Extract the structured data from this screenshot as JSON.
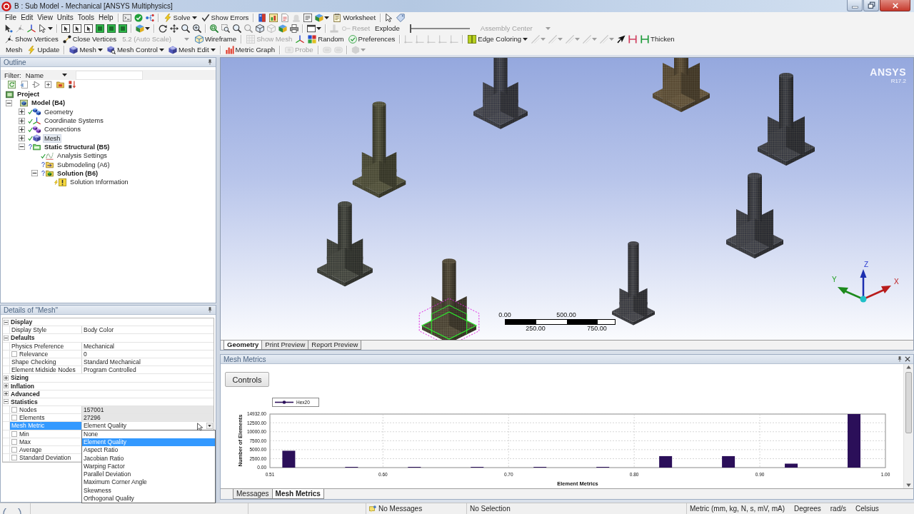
{
  "window": {
    "title": "B : Sub Model - Mechanical [ANSYS Multiphysics]"
  },
  "menu": [
    "File",
    "Edit",
    "View",
    "Units",
    "Tools",
    "Help"
  ],
  "toolbars": [
    {
      "items": [
        {
          "kind": "separator"
        },
        {
          "kind": "icon",
          "dropdown": false,
          "disabled": false
        },
        {
          "kind": "icon",
          "dropdown": false,
          "disabled": false
        },
        {
          "kind": "icon",
          "dropdown": false,
          "disabled": false
        },
        {
          "kind": "separator"
        },
        {
          "kind": "button",
          "label": "Solve",
          "dropdown": true,
          "disabled": false
        },
        {
          "kind": "button",
          "label": "Show Errors",
          "dropdown": false,
          "disabled": false
        },
        {
          "kind": "separator"
        },
        {
          "kind": "icon",
          "dropdown": false,
          "disabled": false
        },
        {
          "kind": "icon",
          "dropdown": false,
          "disabled": false
        },
        {
          "kind": "icon",
          "dropdown": false,
          "disabled": false
        },
        {
          "kind": "icon",
          "dropdown": false,
          "disabled": true
        },
        {
          "kind": "icon",
          "dropdown": false,
          "disabled": false
        },
        {
          "kind": "icon",
          "dropdown": true,
          "disabled": false
        },
        {
          "kind": "button",
          "label": "Worksheet",
          "dropdown": false,
          "disabled": false
        },
        {
          "kind": "separator"
        },
        {
          "kind": "icon",
          "dropdown": false,
          "disabled": false
        },
        {
          "kind": "icon",
          "dropdown": false,
          "disabled": false
        }
      ]
    },
    {
      "items": [
        {
          "kind": "icon",
          "dropdown": false,
          "disabled": false
        },
        {
          "kind": "icon",
          "dropdown": false,
          "disabled": true
        },
        {
          "kind": "icon",
          "dropdown": false,
          "disabled": false
        },
        {
          "kind": "icon",
          "dropdown": true,
          "disabled": false
        },
        {
          "kind": "separator"
        },
        {
          "kind": "icon",
          "dropdown": false,
          "disabled": false
        },
        {
          "kind": "icon",
          "dropdown": false,
          "disabled": false
        },
        {
          "kind": "icon",
          "dropdown": false,
          "disabled": false
        },
        {
          "kind": "icon",
          "dropdown": false,
          "disabled": false
        },
        {
          "kind": "icon",
          "dropdown": false,
          "disabled": false
        },
        {
          "kind": "icon",
          "dropdown": false,
          "disabled": false
        },
        {
          "kind": "separator"
        },
        {
          "kind": "icon",
          "dropdown": true,
          "disabled": false
        },
        {
          "kind": "separator"
        },
        {
          "kind": "icon",
          "dropdown": false,
          "disabled": false
        },
        {
          "kind": "icon",
          "dropdown": false,
          "disabled": false
        },
        {
          "kind": "icon",
          "dropdown": false,
          "disabled": false
        },
        {
          "kind": "icon",
          "dropdown": false,
          "disabled": false
        },
        {
          "kind": "separator"
        },
        {
          "kind": "icon",
          "dropdown": false,
          "disabled": false
        },
        {
          "kind": "icon",
          "dropdown": false,
          "disabled": false
        },
        {
          "kind": "icon",
          "dropdown": false,
          "disabled": false
        },
        {
          "kind": "icon",
          "dropdown": false,
          "disabled": true
        },
        {
          "kind": "icon",
          "dropdown": false,
          "disabled": false
        },
        {
          "kind": "icon",
          "dropdown": false,
          "disabled": true
        },
        {
          "kind": "icon",
          "dropdown": false,
          "disabled": false
        },
        {
          "kind": "icon",
          "dropdown": false,
          "disabled": false
        },
        {
          "kind": "separator"
        },
        {
          "kind": "icon",
          "dropdown": true,
          "disabled": false
        },
        {
          "kind": "separator"
        },
        {
          "kind": "icon",
          "dropdown": false,
          "disabled": true
        },
        {
          "kind": "button",
          "label": "Reset",
          "dropdown": false,
          "disabled": true
        },
        {
          "kind": "text",
          "label": "Explode",
          "disabled": false
        },
        {
          "kind": "slider",
          "level": 0
        },
        {
          "kind": "combo",
          "label": "Assembly Center",
          "dropdown": true,
          "disabled": true
        }
      ]
    },
    {
      "items": [
        {
          "kind": "button",
          "label": "Show Vertices",
          "dropdown": false,
          "disabled": false
        },
        {
          "kind": "button",
          "label": "Close Vertices",
          "dropdown": false,
          "disabled": false
        },
        {
          "kind": "combo",
          "label": "5.2 (Auto Scale)",
          "dropdown": true,
          "disabled": true
        },
        {
          "kind": "button",
          "label": "Wireframe",
          "dropdown": false,
          "disabled": false
        },
        {
          "kind": "separator"
        },
        {
          "kind": "button",
          "label": "Show Mesh",
          "dropdown": false,
          "disabled": true
        },
        {
          "kind": "icon",
          "dropdown": false,
          "disabled": false
        },
        {
          "kind": "button",
          "label": "Random",
          "dropdown": false,
          "disabled": false
        },
        {
          "kind": "button",
          "label": "Preferences",
          "dropdown": false,
          "disabled": false
        },
        {
          "kind": "separator"
        },
        {
          "kind": "icon",
          "dropdown": false,
          "disabled": true
        },
        {
          "kind": "icon",
          "dropdown": false,
          "disabled": true
        },
        {
          "kind": "icon",
          "dropdown": false,
          "disabled": true
        },
        {
          "kind": "icon",
          "dropdown": false,
          "disabled": true
        },
        {
          "kind": "icon",
          "dropdown": false,
          "disabled": true
        },
        {
          "kind": "separator"
        },
        {
          "kind": "button",
          "label": "Edge Coloring",
          "dropdown": true,
          "disabled": false
        },
        {
          "kind": "icon",
          "dropdown": true,
          "disabled": true
        },
        {
          "kind": "icon",
          "dropdown": true,
          "disabled": true
        },
        {
          "kind": "icon",
          "dropdown": true,
          "disabled": true
        },
        {
          "kind": "icon",
          "dropdown": true,
          "disabled": true
        },
        {
          "kind": "icon",
          "dropdown": true,
          "disabled": true
        },
        {
          "kind": "icon",
          "dropdown": false,
          "disabled": false
        },
        {
          "kind": "icon",
          "dropdown": false,
          "disabled": false
        },
        {
          "kind": "button",
          "label": "Thicken",
          "dropdown": false,
          "disabled": false
        }
      ]
    },
    {
      "items": [
        {
          "kind": "text",
          "label": "Mesh",
          "disabled": false
        },
        {
          "kind": "button",
          "label": "Update",
          "dropdown": false,
          "disabled": false
        },
        {
          "kind": "separator"
        },
        {
          "kind": "button",
          "label": "Mesh",
          "dropdown": true,
          "disabled": false
        },
        {
          "kind": "button",
          "label": "Mesh Control",
          "dropdown": true,
          "disabled": false
        },
        {
          "kind": "button",
          "label": "Mesh Edit",
          "dropdown": true,
          "disabled": false
        },
        {
          "kind": "separator"
        },
        {
          "kind": "button",
          "label": "Metric Graph",
          "dropdown": false,
          "disabled": false
        },
        {
          "kind": "separator"
        },
        {
          "kind": "button",
          "label": "Probe",
          "dropdown": false,
          "disabled": true
        },
        {
          "kind": "separator"
        },
        {
          "kind": "icon",
          "dropdown": false,
          "disabled": true
        },
        {
          "kind": "icon",
          "dropdown": false,
          "disabled": true
        },
        {
          "kind": "separator"
        },
        {
          "kind": "icon",
          "dropdown": true,
          "disabled": true
        }
      ]
    }
  ],
  "outline": {
    "title": "Outline",
    "filter_label": "Filter:",
    "filter_by": "Name",
    "tree": [
      {
        "label": "Project",
        "kind": "project",
        "selected": false,
        "children": [
          {
            "label": "Model (B4)",
            "kind": "model",
            "expanded": true,
            "selected": false,
            "children": [
              {
                "label": "Geometry",
                "kind": "geometry",
                "expanded": false,
                "complete": true,
                "selected": false
              },
              {
                "label": "Coordinate Systems",
                "kind": "coordinate_systems",
                "expanded": false,
                "complete": true,
                "selected": false
              },
              {
                "label": "Connections",
                "kind": "connections",
                "expanded": false,
                "complete": true,
                "selected": false
              },
              {
                "label": "Mesh",
                "kind": "mesh",
                "expanded": false,
                "complete": true,
                "selected": true
              },
              {
                "label": "Static Structural (B5)",
                "kind": "static_structural",
                "expanded": true,
                "complete": false,
                "selected": false,
                "children": [
                  {
                    "label": "Analysis Settings",
                    "kind": "analysis_settings",
                    "complete": true,
                    "selected": false
                  },
                  {
                    "label": "Submodeling (A6)",
                    "kind": "submodeling",
                    "complete": false,
                    "selected": false
                  },
                  {
                    "label": "Solution (B6)",
                    "kind": "solution",
                    "expanded": true,
                    "complete": false,
                    "selected": false,
                    "children": [
                      {
                        "label": "Solution Information",
                        "kind": "solution_information",
                        "update_needed": true,
                        "selected": false
                      }
                    ]
                  }
                ]
              }
            ]
          }
        ]
      }
    ]
  },
  "details": {
    "title": "Details of \"Mesh\"",
    "rows": [
      {
        "kind": "category",
        "label": "Display",
        "expanded": true
      },
      {
        "kind": "property",
        "label": "Display Style",
        "value": "Body Color",
        "readonly": false,
        "selected": false
      },
      {
        "kind": "category",
        "label": "Defaults",
        "expanded": true
      },
      {
        "kind": "property",
        "label": "Physics Preference",
        "value": "Mechanical",
        "readonly": false,
        "selected": false
      },
      {
        "kind": "property",
        "label": "Relevance",
        "value": "0",
        "checked": false,
        "readonly": false,
        "selected": false
      },
      {
        "kind": "property",
        "label": "Shape Checking",
        "value": "Standard Mechanical",
        "readonly": false,
        "selected": false
      },
      {
        "kind": "property",
        "label": "Element Midside Nodes",
        "value": "Program Controlled",
        "readonly": false,
        "selected": false
      },
      {
        "kind": "category",
        "label": "Sizing",
        "expanded": false
      },
      {
        "kind": "category",
        "label": "Inflation",
        "expanded": false
      },
      {
        "kind": "category",
        "label": "Advanced",
        "expanded": false
      },
      {
        "kind": "category",
        "label": "Statistics",
        "expanded": true
      },
      {
        "kind": "property",
        "label": "Nodes",
        "value": "157001",
        "checked": false,
        "readonly": true,
        "selected": false
      },
      {
        "kind": "property",
        "label": "Elements",
        "value": "27296",
        "checked": false,
        "readonly": true,
        "selected": false
      },
      {
        "kind": "property",
        "label": "Mesh Metric",
        "value": "Element Quality",
        "readonly": false,
        "selected": true,
        "options": [
          {
            "label": "None",
            "selected": false
          },
          {
            "label": "Element Quality",
            "selected": true
          },
          {
            "label": "Aspect Ratio",
            "selected": false
          },
          {
            "label": "Jacobian Ratio",
            "selected": false
          },
          {
            "label": "Warping Factor",
            "selected": false
          },
          {
            "label": "Parallel Deviation",
            "selected": false
          },
          {
            "label": "Maximum Corner Angle",
            "selected": false
          },
          {
            "label": "Skewness",
            "selected": false
          },
          {
            "label": "Orthogonal Quality",
            "selected": false
          }
        ]
      },
      {
        "kind": "property",
        "label": "Min",
        "checked": false,
        "selected": false
      },
      {
        "kind": "property",
        "label": "Max",
        "checked": false,
        "selected": false
      },
      {
        "kind": "property",
        "label": "Average",
        "checked": false,
        "selected": false
      },
      {
        "kind": "property",
        "label": "Standard Deviation",
        "checked": false,
        "selected": false
      }
    ]
  },
  "viewport": {
    "logo": "ANSYS",
    "version": "R17.2",
    "bodies": [
      {
        "selected": false
      },
      {
        "selected": false
      },
      {
        "selected": false
      },
      {
        "selected": false
      },
      {
        "selected": false
      },
      {
        "selected": false
      },
      {
        "selected": true
      },
      {
        "selected": false
      }
    ],
    "scale_bar": {
      "top_labels": [
        "0.00",
        "500.00"
      ],
      "bottom_labels": [
        "250.00",
        "750.00"
      ]
    },
    "triad": {
      "x": "X",
      "y": "Y",
      "z": "Z"
    },
    "tabs": [
      {
        "label": "Geometry",
        "selected": true
      },
      {
        "label": "Print Preview",
        "selected": false
      },
      {
        "label": "Report Preview",
        "selected": false
      }
    ]
  },
  "mesh_metrics": {
    "title": "Mesh Metrics",
    "controls": "Controls",
    "chart_data": {
      "type": "bar",
      "xlabel": "Element Metrics",
      "ylabel": "Number of Elements",
      "x": [
        0.525,
        0.575,
        0.625,
        0.675,
        0.725,
        0.775,
        0.825,
        0.875,
        0.925,
        0.975
      ],
      "series": [
        {
          "name": "Hex20",
          "color": "#2b0f59",
          "values": [
            4700,
            200,
            200,
            200,
            200,
            200,
            3200,
            3200,
            1100,
            14932
          ]
        }
      ],
      "xlim": [
        0.51,
        1.0
      ],
      "ylim": [
        0,
        14932
      ],
      "xticks": [
        {
          "value": 0.51,
          "label": "0.51"
        },
        {
          "value": 0.6,
          "label": "0.60"
        },
        {
          "value": 0.7,
          "label": "0.70"
        },
        {
          "value": 0.8,
          "label": "0.80"
        },
        {
          "value": 0.9,
          "label": "0.90"
        },
        {
          "value": 1.0,
          "label": "1.00"
        }
      ],
      "yticks": [
        {
          "value": 0,
          "label": "0.00"
        },
        {
          "value": 2500,
          "label": "2500.00"
        },
        {
          "value": 5000,
          "label": "5000.00"
        },
        {
          "value": 7500,
          "label": "7500.00"
        },
        {
          "value": 10000,
          "label": "10000.00"
        },
        {
          "value": 12500,
          "label": "12500.00"
        },
        {
          "value": 14932,
          "label": "14932.00"
        }
      ],
      "grid": true
    },
    "tabs": [
      {
        "label": "Messages",
        "selected": false
      },
      {
        "label": "Mesh Metrics",
        "selected": true
      }
    ]
  },
  "status_bar": {
    "messages": "No Messages",
    "selection": "No Selection",
    "units": "Metric (mm, kg, N, s, mV, mA)",
    "angle": "Degrees",
    "angular_velocity": "rad/s",
    "temperature": "Celsius"
  }
}
